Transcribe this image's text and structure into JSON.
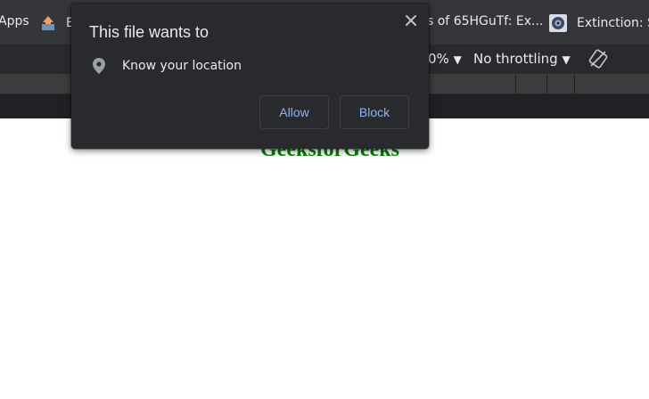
{
  "bookmarks": {
    "apps_label": "Apps",
    "item_e_label": "E",
    "item_65_label": "s of 65HGuTf: Ex...",
    "item_extinction_label": "Extinction: S"
  },
  "devtools": {
    "zoom_value": "0%",
    "throttling_value": "No throttling",
    "dropdown_arrow": "▼"
  },
  "page": {
    "heading": "GeeksforGeeks"
  },
  "permission_popup": {
    "title": "This file wants to",
    "close_icon": "close-icon",
    "permission_icon": "location-pin-icon",
    "permission_text": "Know your location",
    "allow_label": "Allow",
    "block_label": "Block"
  },
  "colors": {
    "popup_background": "#292a2d",
    "button_text": "#8ab4f8",
    "heading_green": "#008000"
  }
}
